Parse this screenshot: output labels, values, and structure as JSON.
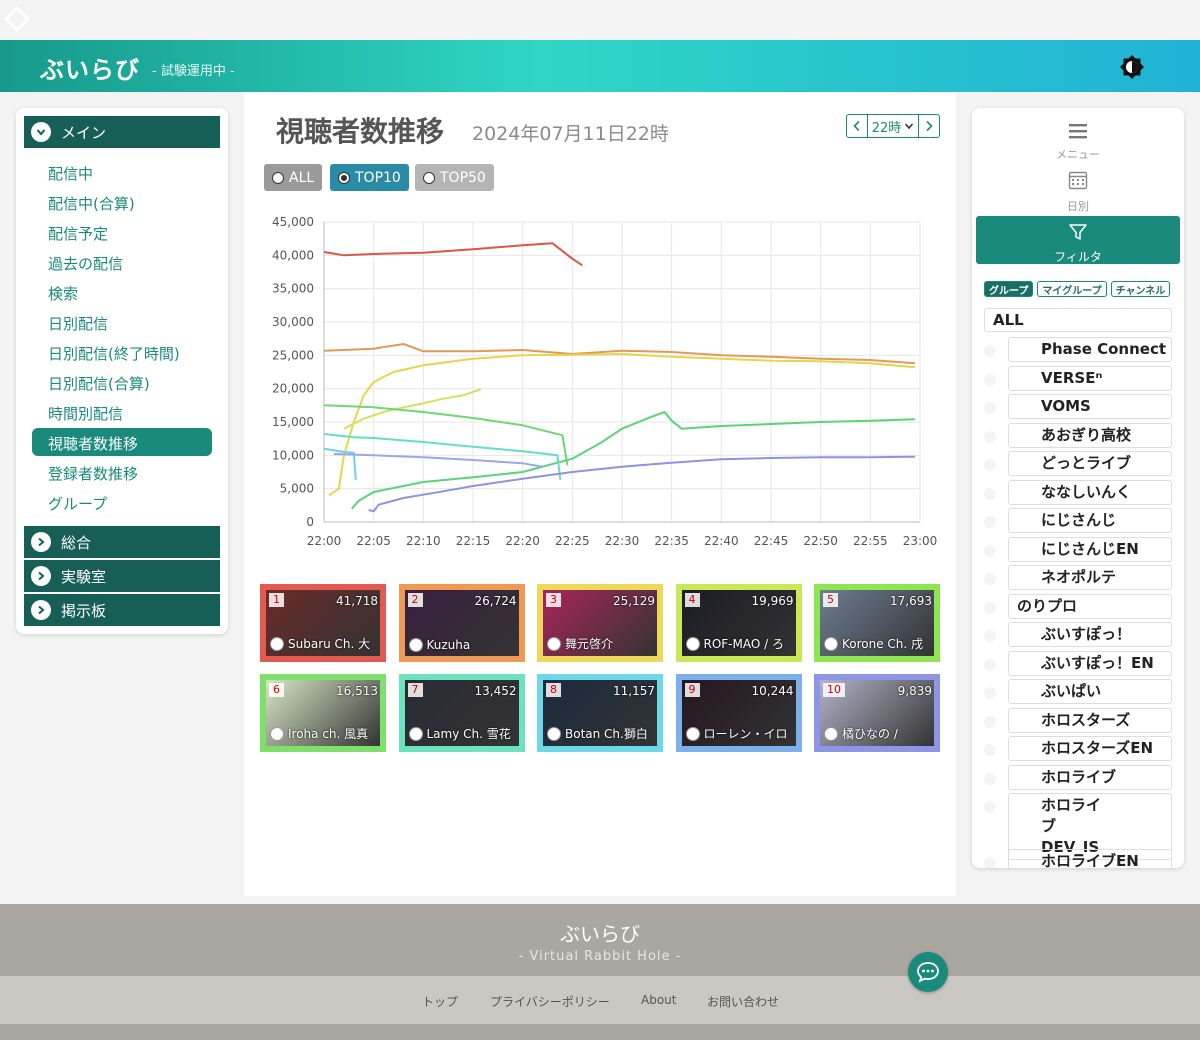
{
  "header": {
    "brand": "ぶいらび",
    "subtitle": "- 試験運用中 -"
  },
  "icons": {
    "logo": "diamond-outline-icon",
    "theme": "theme-toggle-icon",
    "chevron": "chevron-right-icon",
    "menu": "hamburger-icon",
    "calendar": "calendar-icon",
    "filter": "filter-icon",
    "chat": "chat-icon"
  },
  "leftnav": {
    "main_section": "メイン",
    "items": [
      "配信中",
      "配信中(合算)",
      "配信予定",
      "過去の配信",
      "検索",
      "日別配信",
      "日別配信(終了時間)",
      "日別配信(合算)",
      "時間別配信",
      "視聴者数推移",
      "登録者数推移",
      "グループ"
    ],
    "active_index": 9,
    "sections": [
      "総合",
      "実験室",
      "掲示板"
    ]
  },
  "main": {
    "title": "視聴者数推移",
    "date": "2024年07月11日22時",
    "hour_select": "22時",
    "modes": [
      {
        "label": "ALL",
        "selected": false
      },
      {
        "label": "TOP10",
        "selected": true
      },
      {
        "label": "TOP50",
        "selected": false
      }
    ]
  },
  "chart_data": {
    "type": "line",
    "title": "",
    "xlabel": "",
    "ylabel": "",
    "x": [
      "22:00",
      "22:05",
      "22:10",
      "22:15",
      "22:20",
      "22:25",
      "22:30",
      "22:35",
      "22:40",
      "22:45",
      "22:50",
      "22:55",
      "23:00"
    ],
    "ylim": [
      0,
      45000
    ],
    "yticks": [
      "0",
      "5,000",
      "10,000",
      "15,000",
      "20,000",
      "25,000",
      "30,000",
      "35,000",
      "40,000",
      "45,000"
    ],
    "grid": true,
    "series": [
      {
        "color": "#dd5548",
        "points": [
          [
            0,
            40500
          ],
          [
            2,
            40000
          ],
          [
            5,
            40200
          ],
          [
            10,
            40400
          ],
          [
            15,
            40900
          ],
          [
            20,
            41500
          ],
          [
            23,
            41800
          ],
          [
            25,
            39500
          ],
          [
            26,
            38500
          ]
        ]
      },
      {
        "color": "#e29a58",
        "points": [
          [
            0,
            25700
          ],
          [
            5,
            26000
          ],
          [
            8,
            26700
          ],
          [
            10,
            25600
          ],
          [
            15,
            25600
          ],
          [
            20,
            25800
          ],
          [
            25,
            25200
          ],
          [
            30,
            25700
          ],
          [
            35,
            25500
          ],
          [
            40,
            25000
          ],
          [
            45,
            24800
          ],
          [
            50,
            24500
          ],
          [
            55,
            24300
          ],
          [
            59.5,
            23800
          ]
        ]
      },
      {
        "color": "#e8d34c",
        "points": [
          [
            0.5,
            4000
          ],
          [
            1.5,
            5000
          ],
          [
            2,
            10000
          ],
          [
            3,
            15000
          ],
          [
            4,
            19000
          ],
          [
            5,
            21000
          ],
          [
            7,
            22500
          ],
          [
            10,
            23500
          ],
          [
            15,
            24500
          ],
          [
            20,
            25000
          ],
          [
            25,
            25100
          ],
          [
            30,
            25200
          ],
          [
            35,
            24800
          ],
          [
            40,
            24500
          ],
          [
            45,
            24200
          ],
          [
            50,
            24100
          ],
          [
            55,
            23800
          ],
          [
            59.5,
            23200
          ]
        ]
      },
      {
        "color": "#d4e05a",
        "points": [
          [
            2,
            14000
          ],
          [
            4,
            15500
          ],
          [
            6,
            16500
          ],
          [
            8,
            17200
          ],
          [
            10,
            17800
          ],
          [
            12,
            18500
          ],
          [
            14,
            19000
          ],
          [
            15.8,
            19900
          ]
        ]
      },
      {
        "color": "#6ed774",
        "points": [
          [
            0,
            17500
          ],
          [
            5,
            17200
          ],
          [
            10,
            16500
          ],
          [
            15,
            15600
          ],
          [
            20,
            14500
          ],
          [
            24,
            13000
          ],
          [
            24.5,
            8500
          ]
        ]
      },
      {
        "color": "#5bd37a",
        "points": [
          [
            2.8,
            2000
          ],
          [
            3.5,
            3200
          ],
          [
            5,
            4500
          ],
          [
            10,
            6000
          ],
          [
            15,
            6700
          ],
          [
            20,
            7500
          ],
          [
            25,
            9500
          ],
          [
            28,
            12000
          ],
          [
            30,
            14000
          ],
          [
            33,
            15800
          ],
          [
            34.3,
            16500
          ],
          [
            35,
            15200
          ],
          [
            36,
            14000
          ],
          [
            40,
            14400
          ],
          [
            45,
            14700
          ],
          [
            50,
            15000
          ],
          [
            55,
            15200
          ],
          [
            59.5,
            15400
          ]
        ]
      },
      {
        "color": "#63e0c0",
        "points": [
          [
            0,
            13200
          ],
          [
            3,
            12700
          ],
          [
            5,
            12600
          ],
          [
            10,
            12000
          ],
          [
            15,
            11300
          ],
          [
            20,
            10600
          ],
          [
            23.5,
            10000
          ],
          [
            23.8,
            6300
          ]
        ]
      },
      {
        "color": "#6fd0ea",
        "points": [
          [
            0,
            11000
          ],
          [
            2,
            10500
          ],
          [
            3,
            10400
          ],
          [
            3.2,
            6300
          ]
        ]
      },
      {
        "color": "#9aa9e6",
        "points": [
          [
            1,
            10200
          ],
          [
            5,
            10000
          ],
          [
            10,
            9700
          ],
          [
            15,
            9300
          ],
          [
            20,
            8800
          ],
          [
            22,
            8300
          ]
        ]
      },
      {
        "color": "#8e93e0",
        "points": [
          [
            4.5,
            1800
          ],
          [
            5,
            1600
          ],
          [
            5.5,
            2600
          ],
          [
            8,
            3600
          ],
          [
            12,
            4600
          ],
          [
            15,
            5400
          ],
          [
            20,
            6500
          ],
          [
            25,
            7500
          ],
          [
            30,
            8300
          ],
          [
            35,
            8900
          ],
          [
            40,
            9400
          ],
          [
            45,
            9600
          ],
          [
            50,
            9700
          ],
          [
            55,
            9700
          ],
          [
            59.5,
            9800
          ]
        ]
      }
    ]
  },
  "ranking": [
    {
      "rank": "1",
      "count": "41,718",
      "name": "Subaru Ch. 大",
      "border": "#e35a51",
      "bg": "#6b2a2a"
    },
    {
      "rank": "2",
      "count": "26,724",
      "name": "Kuzuha",
      "border": "#ee9a55",
      "bg": "#3a1f3f"
    },
    {
      "rank": "3",
      "count": "25,129",
      "name": "舞元啓介",
      "border": "#ecd85a",
      "bg": "#a9255a"
    },
    {
      "rank": "4",
      "count": "19,969",
      "name": "ROF-MAO / ろ",
      "border": "#c9e857",
      "bg": "#1b1b24"
    },
    {
      "rank": "5",
      "count": "17,693",
      "name": "Korone Ch. 戌",
      "border": "#8ee552",
      "bg": "#6d7d92"
    },
    {
      "rank": "6",
      "count": "16,513",
      "name": "Iroha ch. 風真",
      "border": "#7ee06a",
      "bg": "#d7e6c6"
    },
    {
      "rank": "7",
      "count": "13,452",
      "name": "Lamy Ch. 雪花",
      "border": "#6be3bf",
      "bg": "#2a2a35"
    },
    {
      "rank": "8",
      "count": "11,157",
      "name": "Botan Ch.獅白",
      "border": "#6cd8e8",
      "bg": "#1c2b3f"
    },
    {
      "rank": "9",
      "count": "10,244",
      "name": "ローレン・イロ",
      "border": "#7bb0ea",
      "bg": "#261620"
    },
    {
      "rank": "10",
      "count": "9,839",
      "name": "橘ひなの /",
      "border": "#8d95e6",
      "bg": "#b4b3c9"
    }
  ],
  "rightpanel": {
    "menu_label": "メニュー",
    "daily_label": "日別",
    "filter_label": "フィルタ",
    "tabs": [
      {
        "label": "グループ",
        "selected": true
      },
      {
        "label": "マイグループ",
        "selected": false
      },
      {
        "label": "チャンネル",
        "selected": false
      }
    ],
    "all_label": "ALL",
    "groups": [
      "Phase Connect",
      "VERSEⁿ",
      "VOMS",
      "あおぎり高校",
      "どっとライブ",
      "ななしいんく",
      "にじさんじ",
      "にじさんじEN",
      "ネオポルテ",
      "のりプロ",
      "ぶいすぽっ！",
      "ぶいすぽっ！EN",
      "ぶいぱい",
      "ホロスターズ",
      "ホロスターズEN",
      "ホロライブ",
      "ホロライブ DEV_IS",
      "ホロライブEN"
    ]
  },
  "footer": {
    "brand": "ぶいらび",
    "subtitle": "- Virtual Rabbit Hole -",
    "links": [
      "トップ",
      "プライバシーポリシー",
      "About",
      "お問い合わせ"
    ]
  }
}
